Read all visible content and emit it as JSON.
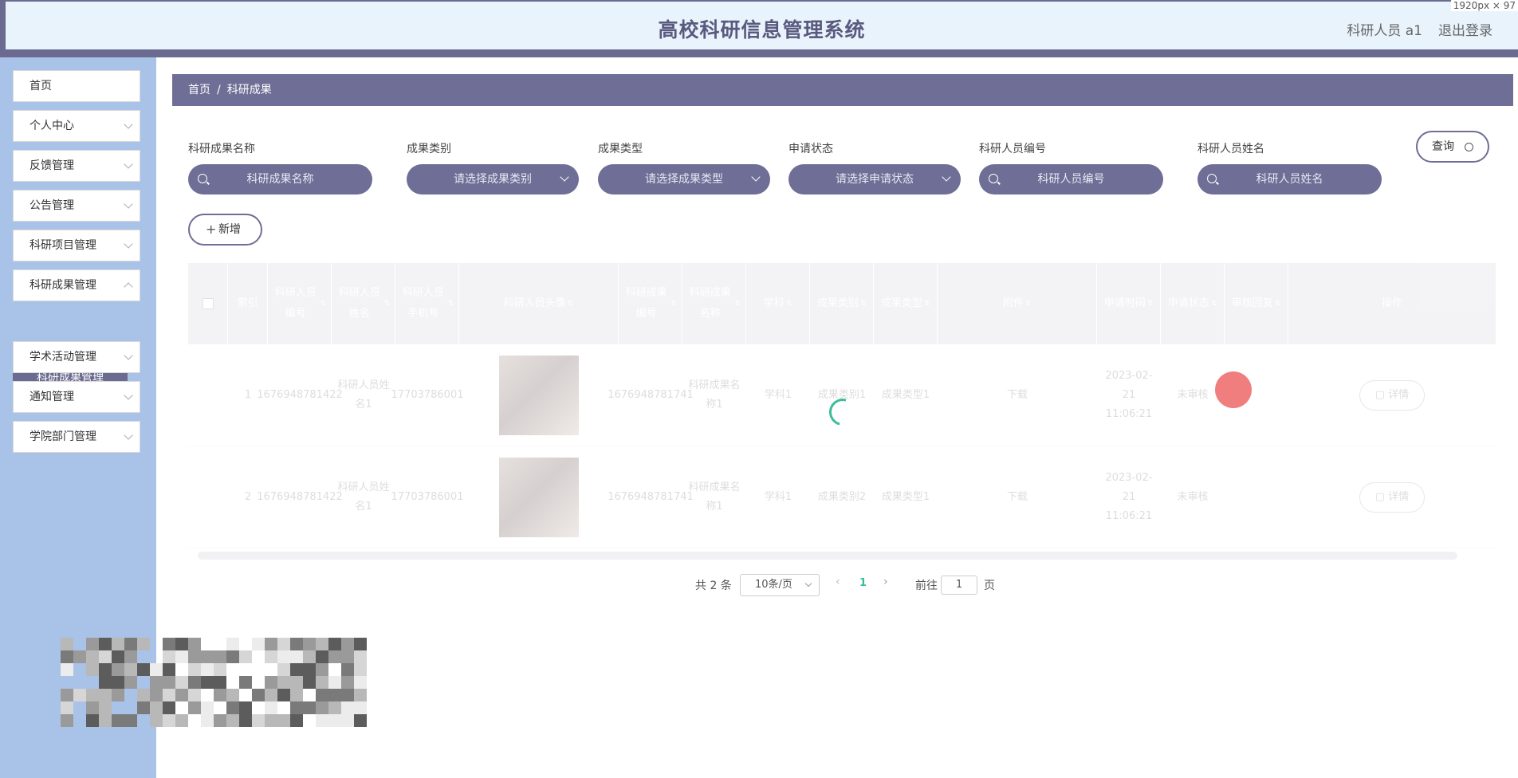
{
  "header": {
    "title": "高校科研信息管理系统",
    "user": "科研人员 a1",
    "logout": "退出登录",
    "screen_size": "1920px × 97"
  },
  "sidebar": {
    "items": [
      {
        "label": "首页",
        "has_arrow": false
      },
      {
        "label": "个人中心",
        "has_arrow": true
      },
      {
        "label": "反馈管理",
        "has_arrow": true
      },
      {
        "label": "公告管理",
        "has_arrow": true
      },
      {
        "label": "科研项目管理",
        "has_arrow": true
      },
      {
        "label": "科研成果管理",
        "has_arrow": true
      },
      {
        "label": "学术活动管理",
        "has_arrow": true
      },
      {
        "label": "通知管理",
        "has_arrow": true
      },
      {
        "label": "学院部门管理",
        "has_arrow": true
      }
    ],
    "active_sub": "科研成果管理"
  },
  "breadcrumb": {
    "home": "首页",
    "separator": "/",
    "current": "科研成果"
  },
  "search": {
    "fields": [
      {
        "label": "科研成果名称",
        "placeholder": "科研成果名称",
        "type": "input"
      },
      {
        "label": "成果类别",
        "placeholder": "请选择成果类别",
        "type": "select"
      },
      {
        "label": "成果类型",
        "placeholder": "请选择成果类型",
        "type": "select"
      },
      {
        "label": "申请状态",
        "placeholder": "请选择申请状态",
        "type": "select"
      },
      {
        "label": "科研人员编号",
        "placeholder": "科研人员编号",
        "type": "input"
      },
      {
        "label": "科研人员姓名",
        "placeholder": "科研人员姓名",
        "type": "input"
      }
    ],
    "query_label": "查询",
    "add_label": "新增"
  },
  "table": {
    "headers": [
      "索引",
      "科研人员编号",
      "科研人员姓名",
      "科研人员手机号",
      "科研人员头像",
      "科研成果编号",
      "科研成果名称",
      "学科",
      "成果类别",
      "成果类型",
      "附件",
      "申请时间",
      "申请状态",
      "审核回复",
      "操作"
    ],
    "rows": [
      [
        "1",
        "1676948781422",
        "科研人员姓名1",
        "17703786001",
        "",
        "1676948781741",
        "科研成果名称1",
        "学科1",
        "成果类别1",
        "成果类型1",
        "下载",
        "2023-02-21 11:06:21",
        "未审核",
        "",
        "详情"
      ],
      [
        "2",
        "1676948781422",
        "科研人员姓名1",
        "17703786001",
        "",
        "1676948781741",
        "科研成果名称1",
        "学科1",
        "成果类别2",
        "成果类型1",
        "下载",
        "2023-02-21 11:06:21",
        "未审核",
        "",
        "详情"
      ]
    ]
  },
  "pagination": {
    "total": "共 2 条",
    "page_size": "10条/页",
    "prev": "‹",
    "current": "1",
    "next": "›",
    "goto_label": "前往",
    "goto_value": "1",
    "page_suffix": "页"
  },
  "colors": {
    "primary": "#6e6e96",
    "sidebar_bg": "#a8c2e8",
    "header_bg": "#e8f3fc",
    "accent": "#3bbd9a"
  }
}
